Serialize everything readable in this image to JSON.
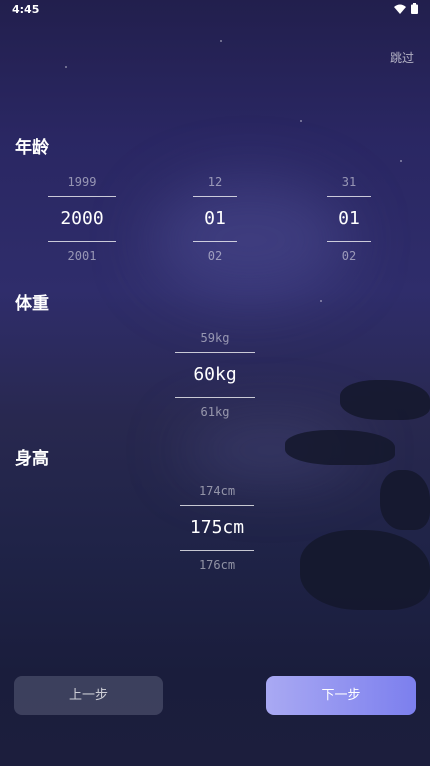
{
  "status": {
    "time": "4:45",
    "icons": [
      "wifi-icon",
      "battery-icon"
    ]
  },
  "header": {
    "skip_label": "跳过"
  },
  "age": {
    "title": "年龄",
    "year": {
      "prev": "1999",
      "current": "2000",
      "next": "2001"
    },
    "month": {
      "prev": "12",
      "current": "01",
      "next": "02"
    },
    "day": {
      "prev": "31",
      "current": "01",
      "next": "02"
    }
  },
  "weight": {
    "title": "体重",
    "prev": "59kg",
    "current": "60kg",
    "next": "61kg"
  },
  "height": {
    "title": "身高",
    "prev": "174cm",
    "current": "175cm",
    "next": "176cm"
  },
  "footer": {
    "prev_label": "上一步",
    "next_label": "下一步"
  },
  "colors": {
    "next_button_start": "#a9a9f3",
    "next_button_end": "#7c7fee",
    "background": "#2a2763"
  }
}
